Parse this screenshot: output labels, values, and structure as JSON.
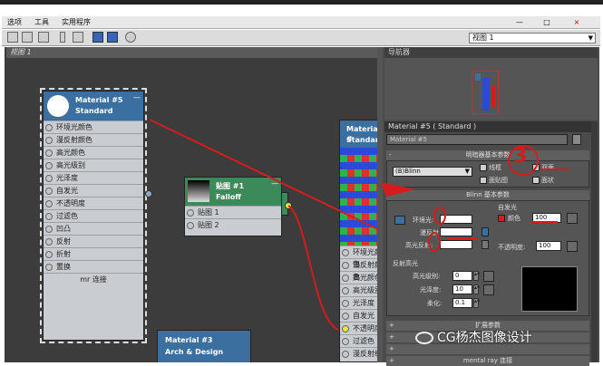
{
  "menubar": {
    "items": [
      "选项",
      "工具",
      "实用程序"
    ],
    "controls": [
      "—",
      "□",
      "×"
    ]
  },
  "toolbar": {
    "view_select": "视图 1"
  },
  "viewport": {
    "label": "视图 1",
    "nodes": {
      "material5": {
        "title": "Material #5",
        "subtitle": "Standard",
        "slots": [
          "环境光颜色",
          "漫反射颜色",
          "高光颜色",
          "高光级别",
          "光泽度",
          "自发光",
          "不透明度",
          "过滤色",
          "凹凸",
          "反射",
          "折射",
          "置换"
        ],
        "footer": "mr 连接"
      },
      "map1": {
        "title": "贴图 #1",
        "subtitle": "Falloff",
        "slots": [
          "贴图 1",
          "贴图 2"
        ]
      },
      "material_right": {
        "title": "Material #",
        "subtitle": "Standard",
        "slots": [
          "环境光颜色",
          "漫反射颜色",
          "高光颜色",
          "高光级别",
          "光泽度",
          "自发光",
          "不透明度",
          "过滤色",
          "漫反射级别"
        ]
      },
      "material3": {
        "title": "Material #3",
        "subtitle": "Arch & Design"
      }
    }
  },
  "panel": {
    "nav_label": "导航器",
    "material_header": "Material #5  ( Standard )",
    "material_name": "Material #5",
    "shader_rollout": "明暗器基本参数",
    "shader_type": "(B)Blinn",
    "checkboxes": {
      "wire": "线框",
      "two_sided": "双面",
      "face_map": "面贴图",
      "faceted": "面状"
    },
    "blinn_rollout": "Blinn 基本参数",
    "self_illum_label": "自发光",
    "color_label": "颜色",
    "self_illum_value": "100",
    "ambient_label": "环境光:",
    "diffuse_label": "漫反射:",
    "specular_label": "高光反射:",
    "opacity_label": "不透明度:",
    "opacity_value": "100",
    "spec_group_label": "反射高光",
    "spec_level_label": "高光级别:",
    "spec_level_value": "0",
    "gloss_label": "光泽度:",
    "gloss_value": "10",
    "soften_label": "柔化:",
    "soften_value": "0.1",
    "extended_rollout": "扩展参数",
    "mental_ray_rollout": "mental ray 连接",
    "annotation_number": "3"
  },
  "colors": {
    "accent_red": "#d41c1c",
    "node_header_blue": "#3a6fa0",
    "node_header_green": "#3c8a5a",
    "wire_yellow": "#e8e83a"
  },
  "watermark": "CG杨杰图像设计"
}
